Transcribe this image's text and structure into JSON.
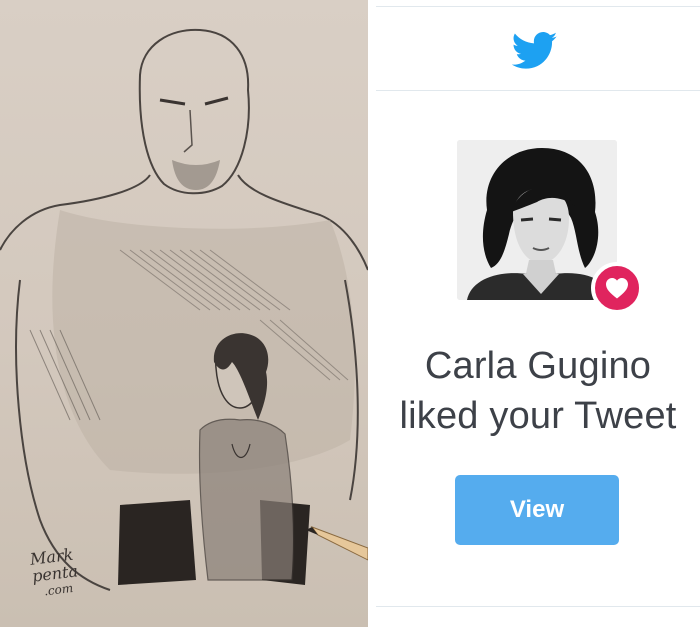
{
  "sketch": {
    "signature_line1": "Mark",
    "signature_line2": "penta",
    "signature_line3": ".com"
  },
  "notification": {
    "icon": "twitter-bird-icon",
    "avatar": "profile-photo",
    "badge_icon": "heart-icon",
    "headline_line1": "Carla Gugino",
    "headline_line2": "liked your Tweet",
    "button_label": "View"
  },
  "colors": {
    "twitter_blue": "#1da1f2",
    "button_blue": "#55acee",
    "heart_red": "#e0245e",
    "headline_text": "#3d4148",
    "paper": "#d6ccc1"
  }
}
